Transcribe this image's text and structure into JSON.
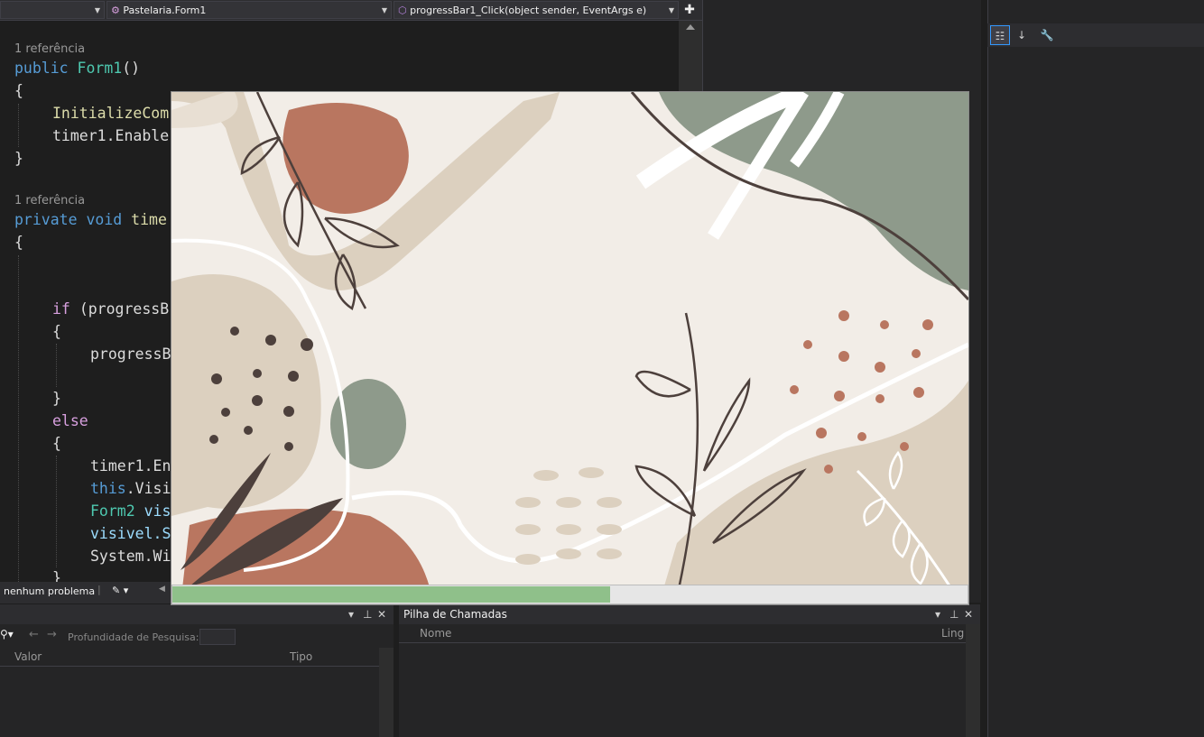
{
  "navbar": {
    "project_combo": "",
    "class_combo": "Pastelaria.Form1",
    "member_combo": "progressBar1_Click(object sender, EventArgs e)"
  },
  "code": {
    "lens1": "1 referência",
    "lens2": "1 referência",
    "l_public": "public",
    "l_form1": "Form1",
    "l_form1_paren": "()",
    "l_brace1": "{",
    "l_init": "InitializeCom",
    "l_timer1": "timer1.Enable",
    "l_brace2": "}",
    "l_private": "private void",
    "l_time": "time",
    "l_brace3": "{",
    "l_if": "if",
    "l_if_rest": "(progressB",
    "l_brace4": "{",
    "l_progress": "progressB",
    "l_brace5": "}",
    "l_else": "else",
    "l_brace6": "{",
    "l_timer_en": "timer1.En",
    "l_this": "this",
    "l_this_rest": ".Visi",
    "l_form2": "Form2",
    "l_form2_rest": "vis",
    "l_visivel": "visivel.S",
    "l_system": "System.Wi",
    "l_brace7": "}"
  },
  "statusbar": {
    "issues": "nenhum problema"
  },
  "locals_panel": {
    "search_depth_label": "Profundidade de Pesquisa:",
    "col_value": "Valor",
    "col_type": "Tipo"
  },
  "callstack_panel": {
    "title": "Pilha de Chamadas",
    "col_name": "Nome",
    "col_lang": "Ling"
  },
  "progress": {
    "value_fraction": 0.55
  },
  "colors": {
    "accent": "#007acc",
    "progress_fill": "#8fc08a",
    "keyword": "#569cd6",
    "type": "#4ec9b0",
    "method": "#dcdcaa"
  }
}
